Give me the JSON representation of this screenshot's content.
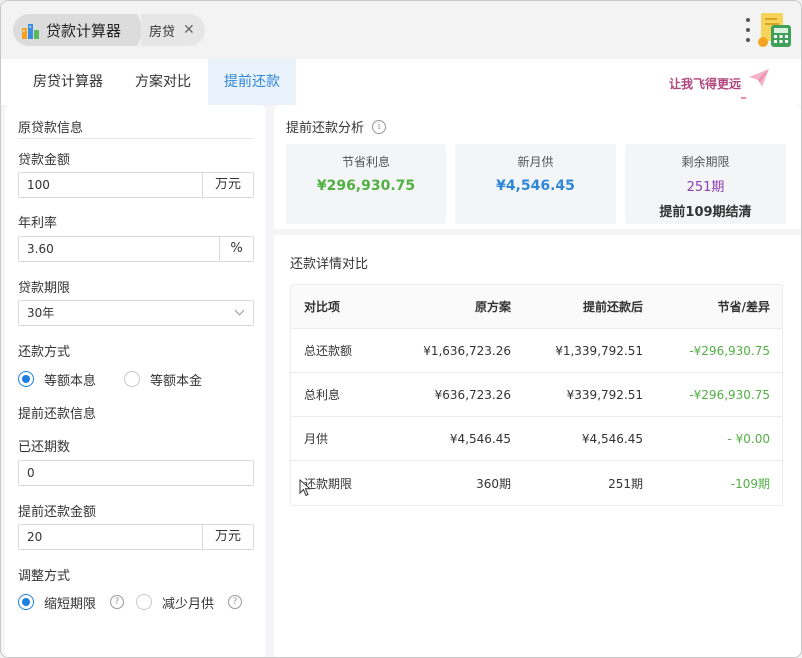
{
  "titlebar": {
    "app_title": "贷款计算器",
    "open_tab": "房贷",
    "close_glyph": "✕"
  },
  "tabs": [
    {
      "label": "房贷计算器",
      "active": false
    },
    {
      "label": "方案对比",
      "active": false
    },
    {
      "label": "提前还款",
      "active": true
    }
  ],
  "promo": {
    "text": "让我飞得更远"
  },
  "form": {
    "original_section": "原贷款信息",
    "loan_amount": {
      "label": "贷款金额",
      "value": "100",
      "unit": "万元"
    },
    "annual_rate": {
      "label": "年利率",
      "value": "3.60",
      "unit": "%"
    },
    "loan_term": {
      "label": "贷款期限",
      "value": "30年"
    },
    "repay_method": {
      "label": "还款方式",
      "options": [
        {
          "label": "等额本息",
          "selected": true
        },
        {
          "label": "等额本金",
          "selected": false
        }
      ]
    },
    "prepay_section": "提前还款信息",
    "paid_periods": {
      "label": "已还期数",
      "value": "0"
    },
    "prepay_amount": {
      "label": "提前还款金额",
      "value": "20",
      "unit": "万元"
    },
    "adjust_method": {
      "label": "调整方式",
      "options": [
        {
          "label": "缩短期限",
          "selected": true
        },
        {
          "label": "减少月供",
          "selected": false
        }
      ],
      "help_glyph": "?"
    }
  },
  "analysis": {
    "title": "提前还款分析",
    "info_glyph": "i",
    "cards": [
      {
        "label": "节省利息",
        "value": "¥296,930.75",
        "color": "#52b043"
      },
      {
        "label": "新月供",
        "value": "¥4,546.45",
        "color": "#2f87d8"
      },
      {
        "label": "剩余期限",
        "value": "251期",
        "sub": "提前109期结清",
        "color": "#8e3fb5"
      }
    ]
  },
  "details": {
    "title": "还款详情对比",
    "headers": [
      "对比项",
      "原方案",
      "提前还款后",
      "节省/差异"
    ],
    "rows": [
      [
        "总还款额",
        "¥1,636,723.26",
        "¥1,339,792.51",
        "-¥296,930.75"
      ],
      [
        "总利息",
        "¥636,723.26",
        "¥339,792.51",
        "-¥296,930.75"
      ],
      [
        "月供",
        "¥4,546.45",
        "¥4,546.45",
        "- ¥0.00"
      ],
      [
        "还款期限",
        "360期",
        "251期",
        "-109期"
      ]
    ]
  }
}
